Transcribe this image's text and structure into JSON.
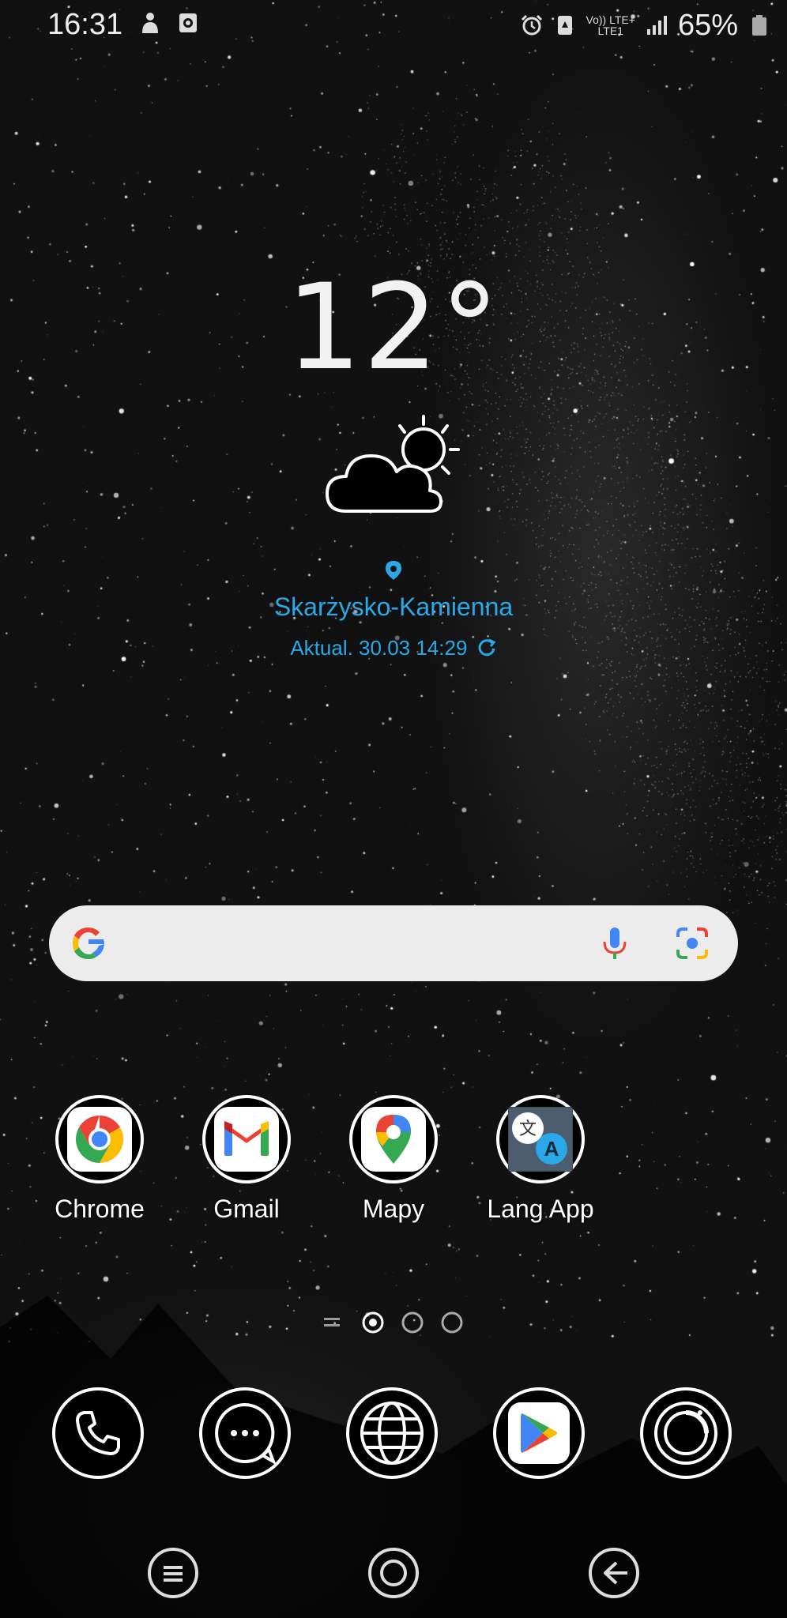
{
  "status_bar": {
    "time": "16:31",
    "volte_top": "Vo)) LTE+",
    "volte_bottom": "LTE1",
    "battery": "65%"
  },
  "weather": {
    "temperature": "12°",
    "condition_icon": "partly-cloudy-icon",
    "location": "Skarżysko-Kamienna",
    "updated": "Aktual. 30.03 14:29"
  },
  "search": {
    "logo": "google-g-icon"
  },
  "apps": [
    {
      "label": "Chrome",
      "icon": "chrome-icon"
    },
    {
      "label": "Gmail",
      "icon": "gmail-icon"
    },
    {
      "label": "Mapy",
      "icon": "maps-icon"
    },
    {
      "label": "Lang App",
      "icon": "translate-icon"
    }
  ],
  "page_indicator": {
    "pages": 3,
    "active": 1
  },
  "dock": [
    {
      "icon": "phone-icon"
    },
    {
      "icon": "messages-icon"
    },
    {
      "icon": "browser-icon"
    },
    {
      "icon": "play-store-icon"
    },
    {
      "icon": "camera-icon"
    }
  ],
  "colors": {
    "accent_blue": "#2aa8e8",
    "background": "#111111",
    "search_bg": "#ececec"
  }
}
